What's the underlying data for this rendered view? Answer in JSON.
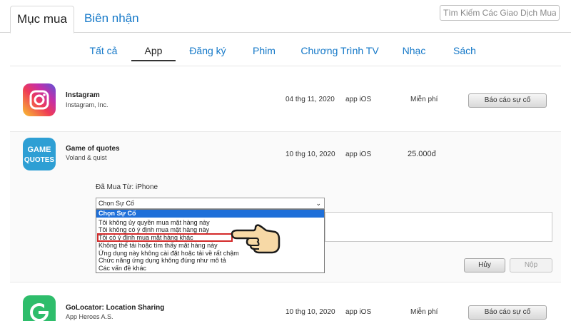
{
  "tabs": {
    "purchased": "Mục mua",
    "receipts": "Biên nhận"
  },
  "search": {
    "placeholder": "Tìm Kiếm Các Giao Dịch Mua H"
  },
  "categories": [
    "Tất cả",
    "App",
    "Đăng ký",
    "Phim",
    "Chương Trình TV",
    "Nhạc",
    "Sách"
  ],
  "active_category": "App",
  "apps": [
    {
      "name": "Instagram",
      "developer": "Instagram, Inc.",
      "date": "04 thg 11, 2020",
      "type": "app iOS",
      "price": "Miễn phí",
      "action": "Báo cáo sự cố",
      "icon": "instagram-icon"
    },
    {
      "name": "Game of quotes",
      "developer": "Voland & quist",
      "date": "10 thg 10, 2020",
      "type": "app iOS",
      "price": "25.000đ",
      "icon": "game-of-quotes-icon",
      "icon_text": "GAME QUOTES"
    },
    {
      "name": "GoLocator: Location Sharing",
      "developer": "App Heroes A.S.",
      "date": "10 thg 10, 2020",
      "type": "app iOS",
      "price": "Miễn phí",
      "action": "Báo cáo sự cố",
      "icon": "golocator-icon"
    }
  ],
  "report": {
    "purchased_from": "Đã Mua Từ: iPhone",
    "select_value": "Chọn Sự Cố",
    "options": [
      "Chọn Sự Cố",
      "Tôi không ủy quyền mua mặt hàng này",
      "Tôi không có ý định mua mặt hàng này",
      "Tôi có ý định mua mặt hàng khác",
      "Không thể tải hoặc tìm thấy mặt hàng này",
      "Ứng dụng này không cài đặt hoặc tải về rất chậm",
      "Chức năng ứng dụng không đúng như mô tả",
      "Các vấn đề khác"
    ],
    "highlighted_option": 0,
    "marked_option": 3,
    "cancel": "Hủy",
    "submit": "Nộp"
  },
  "colors": {
    "link": "#1478c8",
    "highlight": "#1e6fd9",
    "marker": "#d42a2a"
  }
}
